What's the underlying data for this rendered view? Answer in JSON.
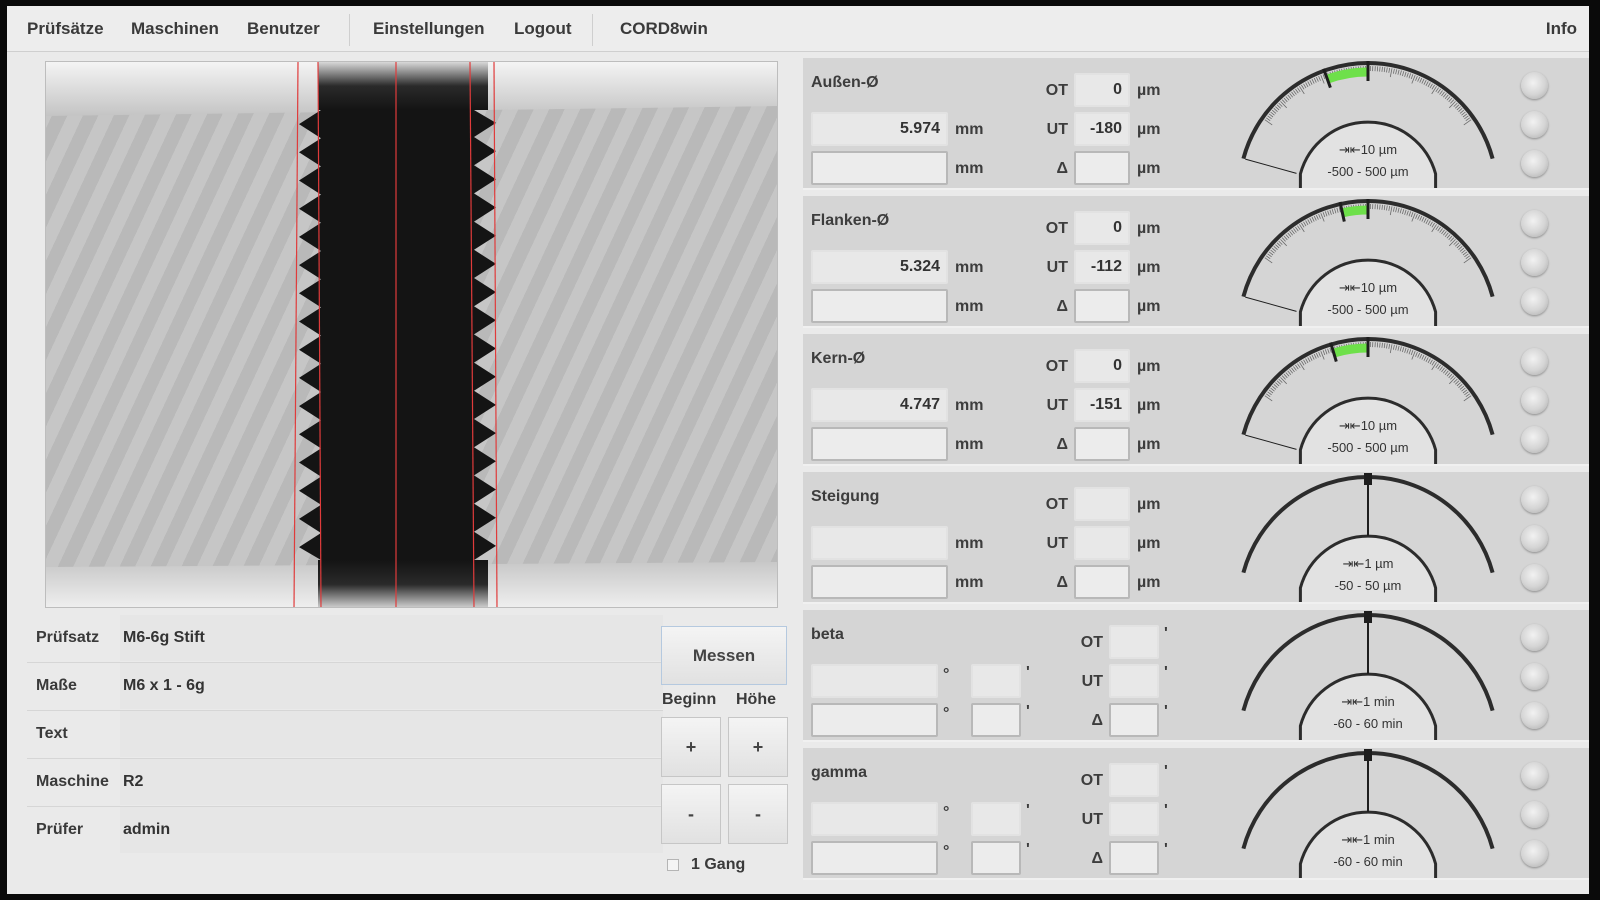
{
  "menu": {
    "items": [
      "Prüfsätze",
      "Maschinen",
      "Benutzer",
      "Einstellungen",
      "Logout",
      "CORD8win"
    ],
    "info": "Info"
  },
  "info_table": {
    "rows": [
      {
        "label": "Prüfsatz",
        "value": "M6-6g Stift"
      },
      {
        "label": "Maße",
        "value": "M6 x 1 - 6g"
      },
      {
        "label": "Text",
        "value": ""
      },
      {
        "label": "Maschine",
        "value": "R2"
      },
      {
        "label": "Prüfer",
        "value": "admin"
      }
    ]
  },
  "controls": {
    "measure_label": "Messen",
    "begin_label": "Beginn",
    "height_label": "Höhe",
    "plus": "+",
    "minus": "-",
    "one_gang_label": "1 Gang"
  },
  "measurements": [
    {
      "title": "Außen-Ø",
      "value": "5.974",
      "unit": "mm",
      "ot": "0",
      "ut": "-180",
      "delta": "",
      "lim_unit": "µm",
      "labels": {
        "ot": "OT",
        "ut": "UT",
        "delta": "Δ"
      },
      "gauge": {
        "resolution": "10 µm",
        "range_text": "-500 - 500 µm",
        "min": -500,
        "max": 500,
        "upper": 0,
        "lower": -180
      }
    },
    {
      "title": "Flanken-Ø",
      "value": "5.324",
      "unit": "mm",
      "ot": "0",
      "ut": "-112",
      "delta": "",
      "lim_unit": "µm",
      "labels": {
        "ot": "OT",
        "ut": "UT",
        "delta": "Δ"
      },
      "gauge": {
        "resolution": "10 µm",
        "range_text": "-500 - 500 µm",
        "min": -500,
        "max": 500,
        "upper": 0,
        "lower": -112
      }
    },
    {
      "title": "Kern-Ø",
      "value": "4.747",
      "unit": "mm",
      "ot": "0",
      "ut": "-151",
      "delta": "",
      "lim_unit": "µm",
      "labels": {
        "ot": "OT",
        "ut": "UT",
        "delta": "Δ"
      },
      "gauge": {
        "resolution": "10 µm",
        "range_text": "-500 - 500 µm",
        "min": -500,
        "max": 500,
        "upper": 0,
        "lower": -151
      }
    },
    {
      "title": "Steigung",
      "value": "",
      "unit": "mm",
      "ot": "",
      "ut": "",
      "delta": "",
      "lim_unit": "µm",
      "labels": {
        "ot": "OT",
        "ut": "UT",
        "delta": "Δ"
      },
      "gauge": {
        "resolution": "1 µm",
        "range_text": "-50 - 50 µm",
        "min": -50,
        "max": 50,
        "upper": null,
        "lower": null
      }
    },
    {
      "title": "beta",
      "deg_unit": "°",
      "min_unit": "'",
      "ot": "",
      "ut": "",
      "delta": "",
      "labels": {
        "ot": "OT",
        "ut": "UT",
        "delta": "Δ"
      },
      "gauge": {
        "resolution": "1 min",
        "range_text": "-60 - 60 min",
        "min": -60,
        "max": 60,
        "upper": null,
        "lower": null
      }
    },
    {
      "title": "gamma",
      "deg_unit": "°",
      "min_unit": "'",
      "ot": "",
      "ut": "",
      "delta": "",
      "labels": {
        "ot": "OT",
        "ut": "UT",
        "delta": "Δ"
      },
      "gauge": {
        "resolution": "1 min",
        "range_text": "-60 - 60 min",
        "min": -60,
        "max": 60,
        "upper": null,
        "lower": null
      }
    }
  ],
  "colors": {
    "in_tolerance": "#6ee04a",
    "contour_lines": "#e03b3b",
    "thread_body": "#141414"
  },
  "icons": {
    "gauge_resolution": "resolution-arrows-icon",
    "status": "status-led-icon"
  }
}
